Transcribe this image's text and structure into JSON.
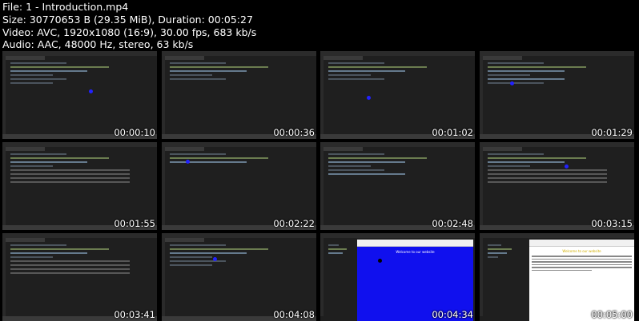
{
  "file_info": {
    "file": "File: 1 - Introduction.mp4",
    "size": "Size: 30770653 B (29.35 MiB), Duration: 00:05:27",
    "video": "Video: AVC, 1920x1080 (16:9), 30.00 fps, 683 kb/s",
    "audio": "Audio: AAC, 48000 Hz, stereo, 63 kb/s"
  },
  "thumbnails": [
    {
      "time": "00:00:10",
      "kind": "editor"
    },
    {
      "time": "00:00:36",
      "kind": "editor"
    },
    {
      "time": "00:01:02",
      "kind": "editor"
    },
    {
      "time": "00:01:29",
      "kind": "editor"
    },
    {
      "time": "00:01:55",
      "kind": "editor"
    },
    {
      "time": "00:02:22",
      "kind": "editor"
    },
    {
      "time": "00:02:48",
      "kind": "editor"
    },
    {
      "time": "00:03:15",
      "kind": "editor"
    },
    {
      "time": "00:03:41",
      "kind": "editor"
    },
    {
      "time": "00:04:08",
      "kind": "editor"
    },
    {
      "time": "00:04:34",
      "kind": "browser-blue",
      "page_title": "Welcome to our website"
    },
    {
      "time": "00:05:00",
      "kind": "browser-white",
      "page_title": "Welcome to our website"
    }
  ]
}
